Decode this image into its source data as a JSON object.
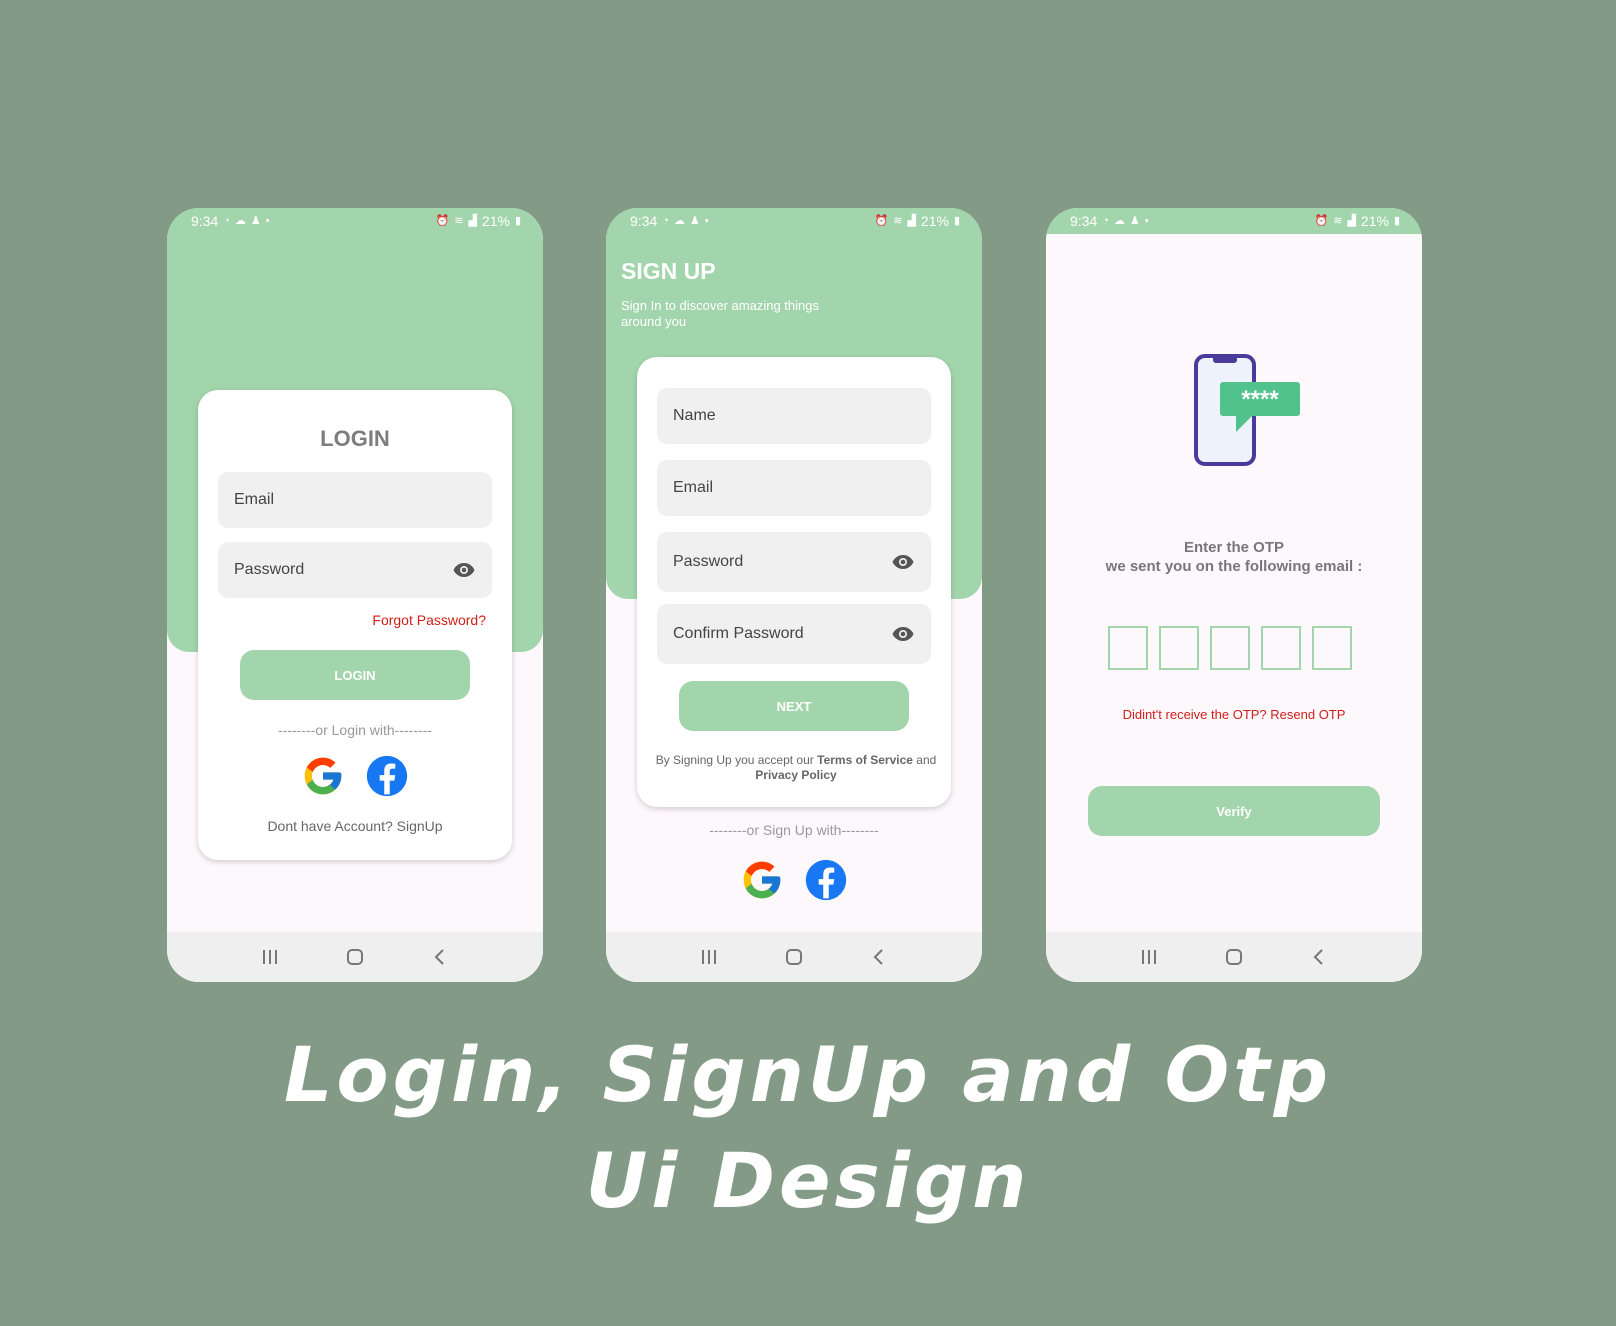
{
  "colors": {
    "background": "#839b86",
    "accent": "#a3d5ad",
    "error": "#d0201a"
  },
  "status_bar": {
    "time": "9:34",
    "battery": "21%"
  },
  "login": {
    "title": "LOGIN",
    "email_placeholder": "Email",
    "password_placeholder": "Password",
    "forgot_password": "Forgot Password?",
    "login_button": "LOGIN",
    "divider": "--------or Login with--------",
    "signup_prompt": "Dont have Account? SignUp"
  },
  "signup": {
    "title": "SIGN UP",
    "subtitle": "Sign In to discover amazing things around you",
    "name_placeholder": "Name",
    "email_placeholder": "Email",
    "password_placeholder": "Password",
    "confirm_password_placeholder": "Confirm Password",
    "next_button": "NEXT",
    "terms_prefix": "By Signing Up you accept our ",
    "terms_of_service": "Terms of Service",
    "terms_and": " and ",
    "privacy_policy": "Privacy Policy",
    "divider": "--------or Sign Up with--------"
  },
  "otp": {
    "instruction_line1": "Enter the OTP",
    "instruction_line2": "we sent you on the following email :",
    "otp_digits": [
      "",
      "",
      "",
      "",
      ""
    ],
    "resend_text": "Didint't receive the OTP? Resend OTP",
    "verify_button": "Verify",
    "illustration_code": "****"
  },
  "headline": {
    "line1": "Login, SignUp and Otp",
    "line2": "Ui Design"
  },
  "icons": [
    "whatsapp-icon",
    "cloud-icon",
    "snapchat-icon",
    "alarm-icon",
    "wifi-icon",
    "signal-icon",
    "battery-icon",
    "eye-icon",
    "google-icon",
    "facebook-icon",
    "recents-icon",
    "home-icon",
    "back-icon"
  ]
}
